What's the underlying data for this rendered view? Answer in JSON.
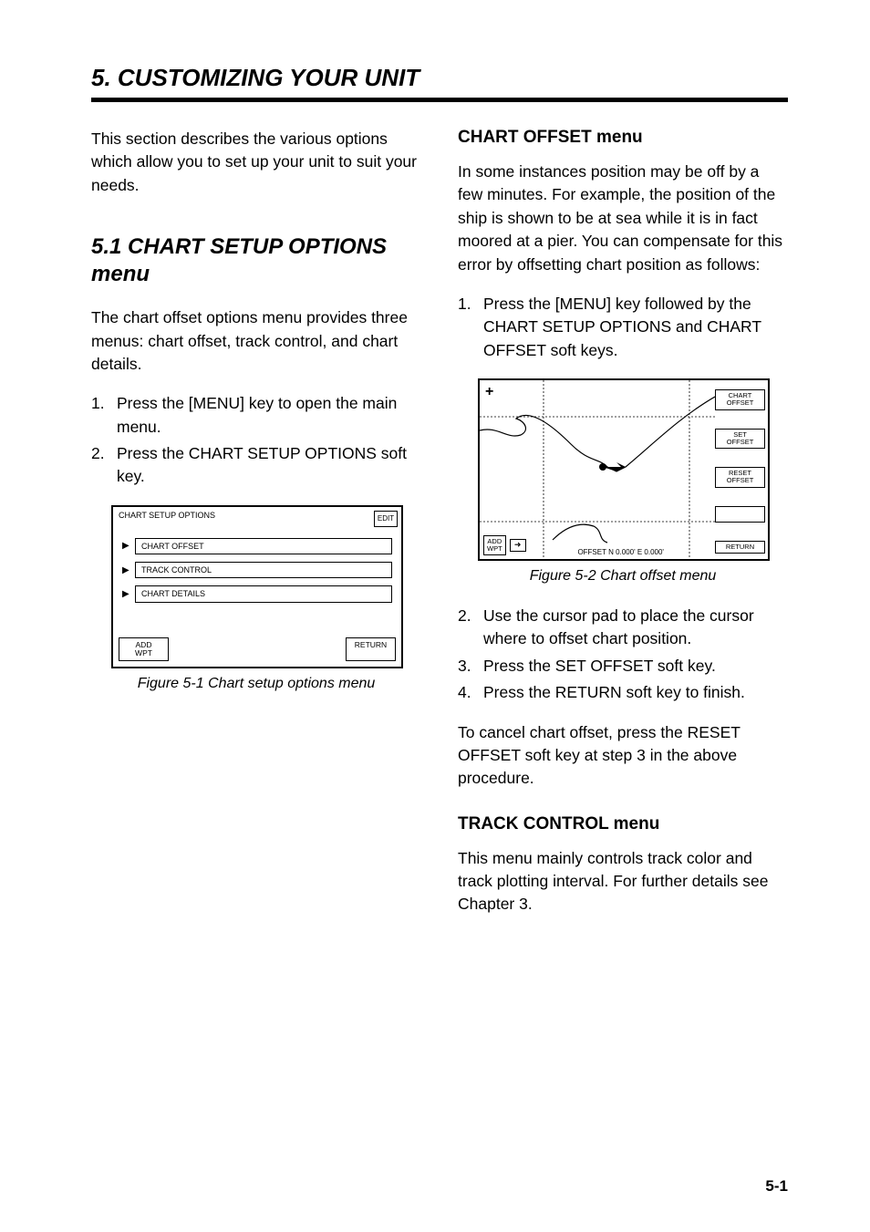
{
  "chapter_label": "5. CUSTOMIZING YOUR UNIT",
  "intro": "This section describes the various options which allow you to set up your unit to suit your needs.",
  "section51": {
    "heading": "5.1 CHART SETUP OPTIONS menu",
    "para": "The chart offset options menu provides three menus: chart offset, track control, and chart details.",
    "steps": [
      "Press the [MENU] key to open the main menu.",
      "Press the CHART SETUP OPTIONS soft key."
    ],
    "fig": {
      "title": "CHART SETUP OPTIONS",
      "edit": "EDIT",
      "options": [
        "CHART OFFSET",
        "TRACK CONTROL",
        "CHART DETAILS"
      ],
      "arrow": "▶",
      "btn_waypoint": "ADD\nWPT",
      "btn_return": "RETURN",
      "caption": "Figure 5-1 Chart setup options menu"
    }
  },
  "chart_offset": {
    "heading": "CHART OFFSET menu",
    "para": "In some instances position may be off by a few minutes. For example, the position of the ship is shown to be at sea while it is in fact moored at a pier. You can compensate for this error by offsetting chart position as follows:",
    "steps_a": [
      "Press the [MENU] key followed by the CHART SETUP OPTIONS and CHART OFFSET soft keys."
    ],
    "fig": {
      "plus": "+",
      "offset_text": "OFFSET    N  0.000'     E  0.000'",
      "side_buttons": [
        "CHART\nOFFSET",
        "SET\nOFFSET",
        "RESET\nOFFSET",
        "",
        "RETURN"
      ],
      "bottom_button": "ADD\nWPT",
      "card": "➜",
      "caption": "Figure 5-2 Chart offset menu"
    },
    "steps_b": [
      "Use the cursor pad to place the cursor where to offset chart position.",
      "Press the SET OFFSET soft key.",
      "Press the RETURN soft key to finish."
    ],
    "cancel": "To cancel chart offset, press the RESET OFFSET soft key at step 3 in the above procedure."
  },
  "track_control": {
    "heading": "TRACK CONTROL menu",
    "para": "This menu mainly controls track color and track plotting interval. For further details see Chapter 3."
  },
  "page_number": "5-1"
}
